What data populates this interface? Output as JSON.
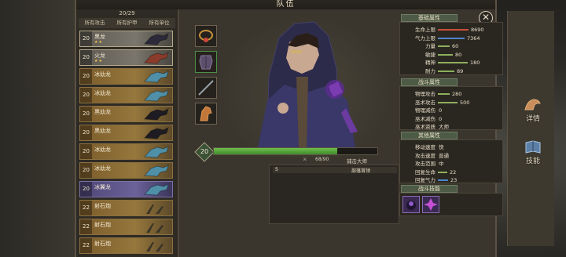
{
  "window": {
    "title": "队伍",
    "close_symbol": "✕"
  },
  "roster": {
    "count": "20/29",
    "filters": [
      "所有攻击",
      "所有护甲",
      "所有单位"
    ],
    "units": [
      {
        "level": "20",
        "name": "黑龙",
        "stars": "★★",
        "style": "sel",
        "art": "dragon-dark"
      },
      {
        "level": "20",
        "name": "火龙",
        "stars": "★★",
        "style": "sel",
        "art": "dragon-red"
      },
      {
        "level": "20",
        "name": "冰幼龙",
        "stars": "",
        "style": "gold",
        "art": "dragon-ice"
      },
      {
        "level": "20",
        "name": "冰幼龙",
        "stars": "",
        "style": "gold",
        "art": "dragon-ice"
      },
      {
        "level": "20",
        "name": "黑幼龙",
        "stars": "",
        "style": "gold",
        "art": "dragon-black"
      },
      {
        "level": "20",
        "name": "黑幼龙",
        "stars": "",
        "style": "gold",
        "art": "dragon-black"
      },
      {
        "level": "20",
        "name": "冰幼龙",
        "stars": "",
        "style": "gold",
        "art": "dragon-ice"
      },
      {
        "level": "20",
        "name": "冰幼龙",
        "stars": "",
        "style": "gold",
        "art": "dragon-ice"
      },
      {
        "level": "20",
        "name": "冰翼龙",
        "stars": "",
        "style": "purple",
        "art": "dragon-ice"
      },
      {
        "level": "22",
        "name": "射石炮",
        "stars": "",
        "style": "gold",
        "art": "catapult"
      },
      {
        "level": "22",
        "name": "射石炮",
        "stars": "",
        "style": "gold",
        "art": "catapult"
      },
      {
        "level": "22",
        "name": "射石炮",
        "stars": "",
        "style": "gold",
        "art": "catapult"
      }
    ]
  },
  "hero": {
    "level": "20",
    "xp_text": "68/90",
    "xp_fraction": 0.755,
    "title": "捕击大师",
    "rank_num": "5",
    "rank_label": "部落首领"
  },
  "stats": {
    "base": {
      "header": "基础属性",
      "rows": [
        {
          "label": "生命上限",
          "value": "8690",
          "color": "#c9503a",
          "fraction": 0.93
        },
        {
          "label": "气力上限",
          "value": "7364",
          "color": "#4e86c9",
          "fraction": 0.8
        },
        {
          "label": "力量",
          "value": "60",
          "color": "#8fb05c",
          "fraction": 0.3
        },
        {
          "label": "敏捷",
          "value": "80",
          "color": "#8fb05c",
          "fraction": 0.4
        },
        {
          "label": "精神",
          "value": "180",
          "color": "#8fb05c",
          "fraction": 0.9
        },
        {
          "label": "耐力",
          "value": "89",
          "color": "#8fb05c",
          "fraction": 0.45
        }
      ]
    },
    "combat": {
      "header": "战斗属性",
      "rows": [
        {
          "label": "物理攻击",
          "value": "280",
          "color": "#8fb05c",
          "fraction": 0.3
        },
        {
          "label": "巫术攻击",
          "value": "500",
          "color": "#8fb05c",
          "fraction": 0.55
        },
        {
          "label": "物理减伤",
          "value": "0",
          "color": "",
          "fraction": 0
        },
        {
          "label": "巫术减伤",
          "value": "0",
          "color": "",
          "fraction": 0
        },
        {
          "label": "巫术资质",
          "value": "大师",
          "color": "",
          "fraction": 0
        }
      ]
    },
    "other": {
      "header": "其他属性",
      "rows": [
        {
          "label": "移动速度",
          "value": "快",
          "color": "",
          "fraction": 0
        },
        {
          "label": "攻击速度",
          "value": "普通",
          "color": "",
          "fraction": 0
        },
        {
          "label": "攻击范围",
          "value": "中",
          "color": "",
          "fraction": 0
        },
        {
          "label": "回复生命",
          "value": "22",
          "color": "#8fb05c",
          "fraction": 0.22
        },
        {
          "label": "回复气力",
          "value": "23",
          "color": "#4e86c9",
          "fraction": 0.23
        }
      ]
    },
    "skills": {
      "header": "战斗技能"
    }
  },
  "tabs": [
    {
      "label": "详情",
      "icon": "arm-icon"
    },
    {
      "label": "技能",
      "icon": "book-icon"
    }
  ]
}
